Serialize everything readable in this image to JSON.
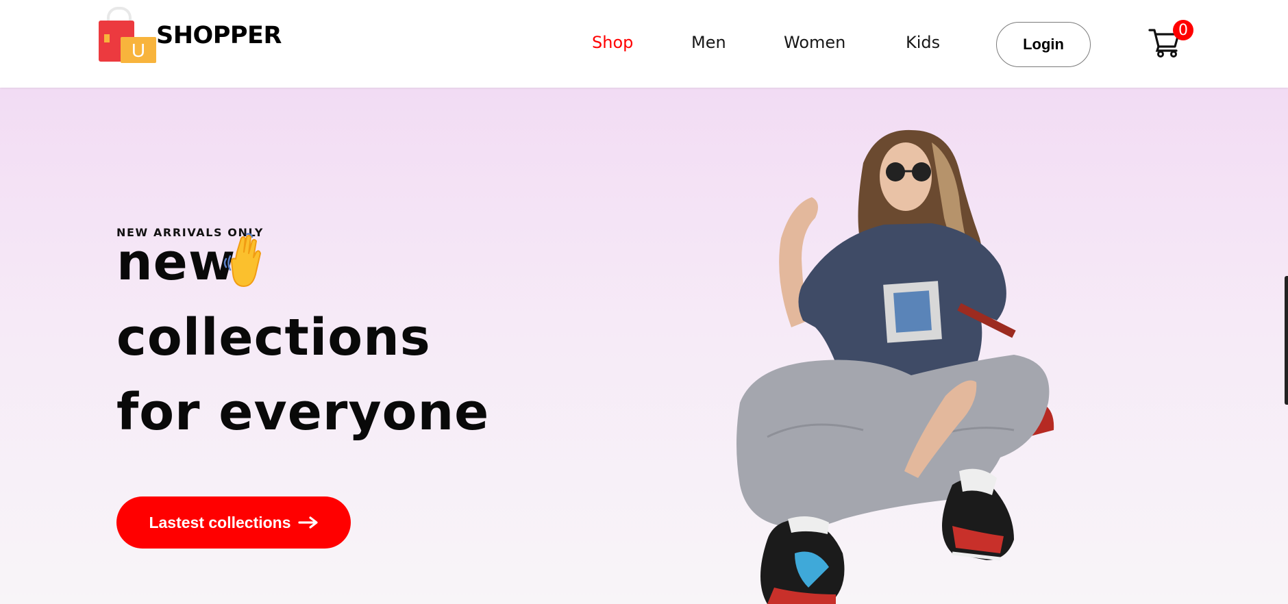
{
  "brand": {
    "name": "SHOPPER",
    "logo_letter": "U",
    "icon": "shopping-bags-logo"
  },
  "nav": {
    "items": [
      {
        "label": "Shop",
        "active": true
      },
      {
        "label": "Men",
        "active": false
      },
      {
        "label": "Women",
        "active": false
      },
      {
        "label": "Kids",
        "active": false
      }
    ],
    "login_label": "Login",
    "cart_icon": "cart-icon",
    "cart_count": "0"
  },
  "hero": {
    "kicker": "NEW ARRIVALS ONLY",
    "line1": "new",
    "line2": "collections",
    "line3": "for everyone",
    "wave_icon": "hand-wave-icon",
    "cta_label": "Lastest collections",
    "cta_icon": "arrow-right-icon",
    "image": "hero-model-image"
  },
  "colors": {
    "accent": "#ff0000",
    "hero_top": "#f2dcf4",
    "hero_bottom": "#f8f5f8",
    "text": "#090909"
  }
}
